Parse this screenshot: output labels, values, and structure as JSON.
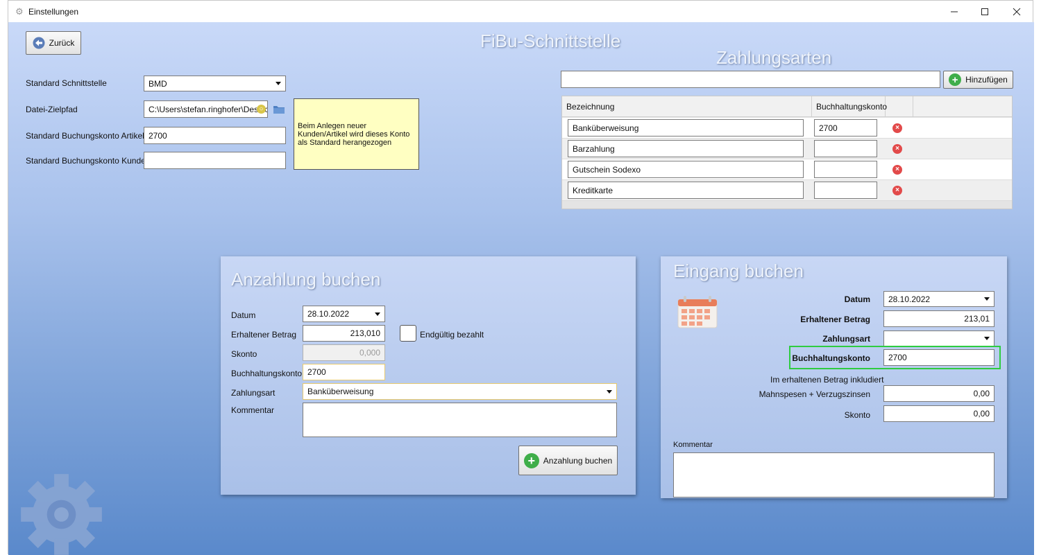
{
  "window": {
    "title": "Einstellungen"
  },
  "header": {
    "back_label": "Zurück",
    "title": "FiBu-Schnittstelle"
  },
  "settings": {
    "standard_interface_label": "Standard Schnittstelle",
    "standard_interface_value": "BMD",
    "target_path_label": "Datei-Zielpfad",
    "target_path_value": "C:\\Users\\stefan.ringhofer\\Desktop",
    "article_account_label": "Standard Buchungskonto Artikel",
    "article_account_value": "2700",
    "customer_account_label": "Standard Buchungskonto Kunde",
    "customer_account_value": "",
    "note_text": "Beim Anlegen neuer Kunden/Artikel wird dieses Konto als Standard herangezogen"
  },
  "payment_types": {
    "title": "Zahlungsarten",
    "new_value": "",
    "add_label": "Hinzufügen",
    "columns": [
      "Bezeichnung",
      "Buchhaltungskonto"
    ],
    "rows": [
      {
        "name": "Banküberweisung",
        "account": "2700"
      },
      {
        "name": "Barzahlung",
        "account": ""
      },
      {
        "name": "Gutschein Sodexo",
        "account": ""
      },
      {
        "name": "Kreditkarte",
        "account": ""
      }
    ]
  },
  "deposit": {
    "title": "Anzahlung buchen",
    "date_label": "Datum",
    "date_value": "28.10.2022",
    "amount_label": "Erhaltener Betrag",
    "amount_value": "213,010",
    "final_paid_label": "Endgültig bezahlt",
    "discount_label": "Skonto",
    "discount_value": "0,000",
    "account_label": "Buchhaltungskonto",
    "account_value": "2700",
    "payment_type_label": "Zahlungsart",
    "payment_type_value": "Banküberweisung",
    "comment_label": "Kommentar",
    "comment_value": "",
    "submit_label": "Anzahlung buchen"
  },
  "incoming": {
    "title": "Eingang buchen",
    "date_label": "Datum",
    "date_value": "28.10.2022",
    "amount_label": "Erhaltener Betrag",
    "amount_value": "213,01",
    "payment_type_label": "Zahlungsart",
    "payment_type_value": "",
    "account_label": "Buchhaltungskonto",
    "account_value": "2700",
    "included_note": "Im erhaltenen Betrag inkludiert",
    "fees_label": "Mahnspesen + Verzugszinsen",
    "fees_value": "0,00",
    "discount_label": "Skonto",
    "discount_value": "0,00",
    "comment_label": "Kommentar",
    "comment_value": ""
  },
  "icons": {
    "app": "gear-icon",
    "back": "arrow-left-icon",
    "folder": "folder-icon",
    "add": "plus-icon",
    "delete": "delete-icon",
    "calendar": "calendar-icon",
    "watermark": "gear-icon"
  },
  "colors": {
    "highlight": "#2ecc40",
    "note_bg": "#ffffc2",
    "delete": "#e24a4a",
    "add": "#3fae4a"
  }
}
